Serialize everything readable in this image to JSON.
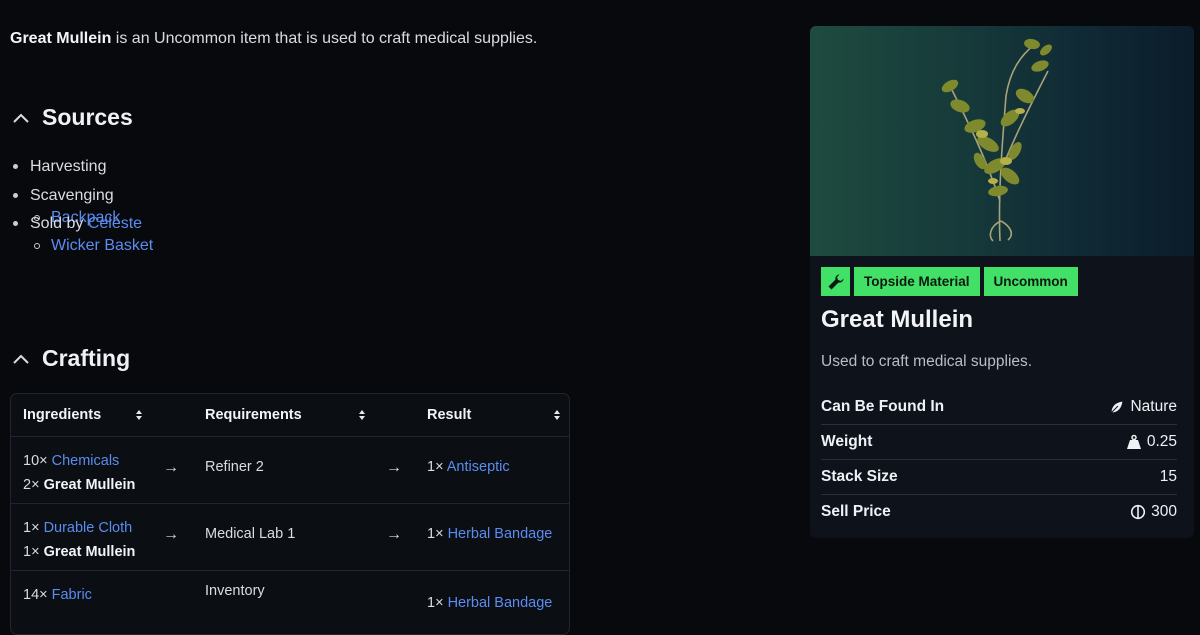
{
  "intro": {
    "item_name": "Great Mullein",
    "text": " is an Uncommon item that is used to craft medical supplies."
  },
  "sources": {
    "heading": "Sources",
    "items": [
      "Harvesting",
      "Scavenging"
    ],
    "scavenging_sub": [
      "Backpack",
      "Wicker Basket"
    ],
    "sold_by_prefix": "Sold by ",
    "sold_by_vendor": "Celeste"
  },
  "crafting": {
    "heading": "Crafting",
    "columns": [
      "Ingredients",
      "Requirements",
      "Result"
    ],
    "arrow": "→",
    "rows": [
      {
        "ing1_qty": "10× ",
        "ing1_name": "Chemicals",
        "ing2_qty": "2× ",
        "ing2_name": "Great Mullein",
        "requirement": "Refiner 2",
        "result_qty": "1× ",
        "result_name": "Antiseptic"
      },
      {
        "ing1_qty": "1× ",
        "ing1_name": "Durable Cloth",
        "ing2_qty": "1× ",
        "ing2_name": "Great Mullein",
        "requirement": "Medical Lab 1",
        "result_qty": "1× ",
        "result_name": "Herbal Bandage"
      },
      {
        "ing1_qty": "14× ",
        "ing1_name": "Fabric",
        "requirement": "Inventory",
        "result_qty": "1× ",
        "result_name": "Herbal Bandage"
      }
    ]
  },
  "card": {
    "tags": [
      "Topside Material",
      "Uncommon"
    ],
    "title": "Great Mullein",
    "description": "Used to craft medical supplies.",
    "stats": [
      {
        "label": "Can Be Found In",
        "value": "Nature",
        "icon": "leaf-icon"
      },
      {
        "label": "Weight",
        "value": "0.25",
        "icon": "weight-icon"
      },
      {
        "label": "Stack Size",
        "value": "15",
        "icon": ""
      },
      {
        "label": "Sell Price",
        "value": "300",
        "icon": "coin-icon"
      }
    ]
  },
  "colors": {
    "accent_green": "#43e067",
    "link": "#5b8cf0"
  }
}
